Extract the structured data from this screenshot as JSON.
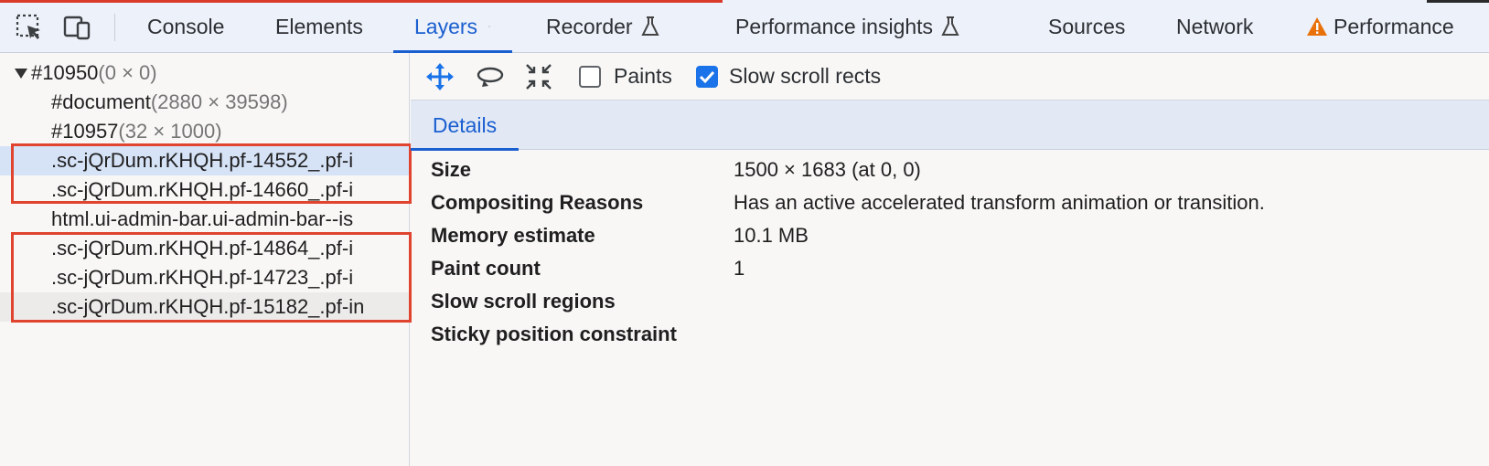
{
  "tabs": {
    "console": "Console",
    "elements": "Elements",
    "layers": "Layers",
    "recorder": "Recorder",
    "performance_insights": "Performance insights",
    "sources": "Sources",
    "network": "Network",
    "performance": "Performance"
  },
  "toolbar": {
    "paints_label": "Paints",
    "paints_checked": false,
    "slow_scroll_label": "Slow scroll rects",
    "slow_scroll_checked": true
  },
  "tree": {
    "rows": [
      {
        "name": "#10950",
        "dim": "(0 × 0)"
      },
      {
        "name": "#document",
        "dim": "(2880 × 39598)"
      },
      {
        "name": "#10957",
        "dim": "(32 × 1000)"
      },
      {
        "name": ".sc-jQrDum.rKHQH.pf-14552_.pf-i"
      },
      {
        "name": ".sc-jQrDum.rKHQH.pf-14660_.pf-i"
      },
      {
        "name": "html.ui-admin-bar.ui-admin-bar--is"
      },
      {
        "name": ".sc-jQrDum.rKHQH.pf-14864_.pf-i"
      },
      {
        "name": ".sc-jQrDum.rKHQH.pf-14723_.pf-i"
      },
      {
        "name": ".sc-jQrDum.rKHQH.pf-15182_.pf-in"
      }
    ]
  },
  "details": {
    "tab_label": "Details",
    "rows": [
      {
        "label": "Size",
        "value": "1500 × 1683 (at 0, 0)"
      },
      {
        "label": "Compositing Reasons",
        "value": "Has an active accelerated transform animation or transition."
      },
      {
        "label": "Memory estimate",
        "value": "10.1 MB"
      },
      {
        "label": "Paint count",
        "value": "1"
      },
      {
        "label": "Slow scroll regions",
        "value": ""
      },
      {
        "label": "Sticky position constraint",
        "value": ""
      }
    ]
  },
  "colors": {
    "accent": "#1a5fd0",
    "highlight_box": "#e0442f",
    "warning": "#e8710a"
  }
}
